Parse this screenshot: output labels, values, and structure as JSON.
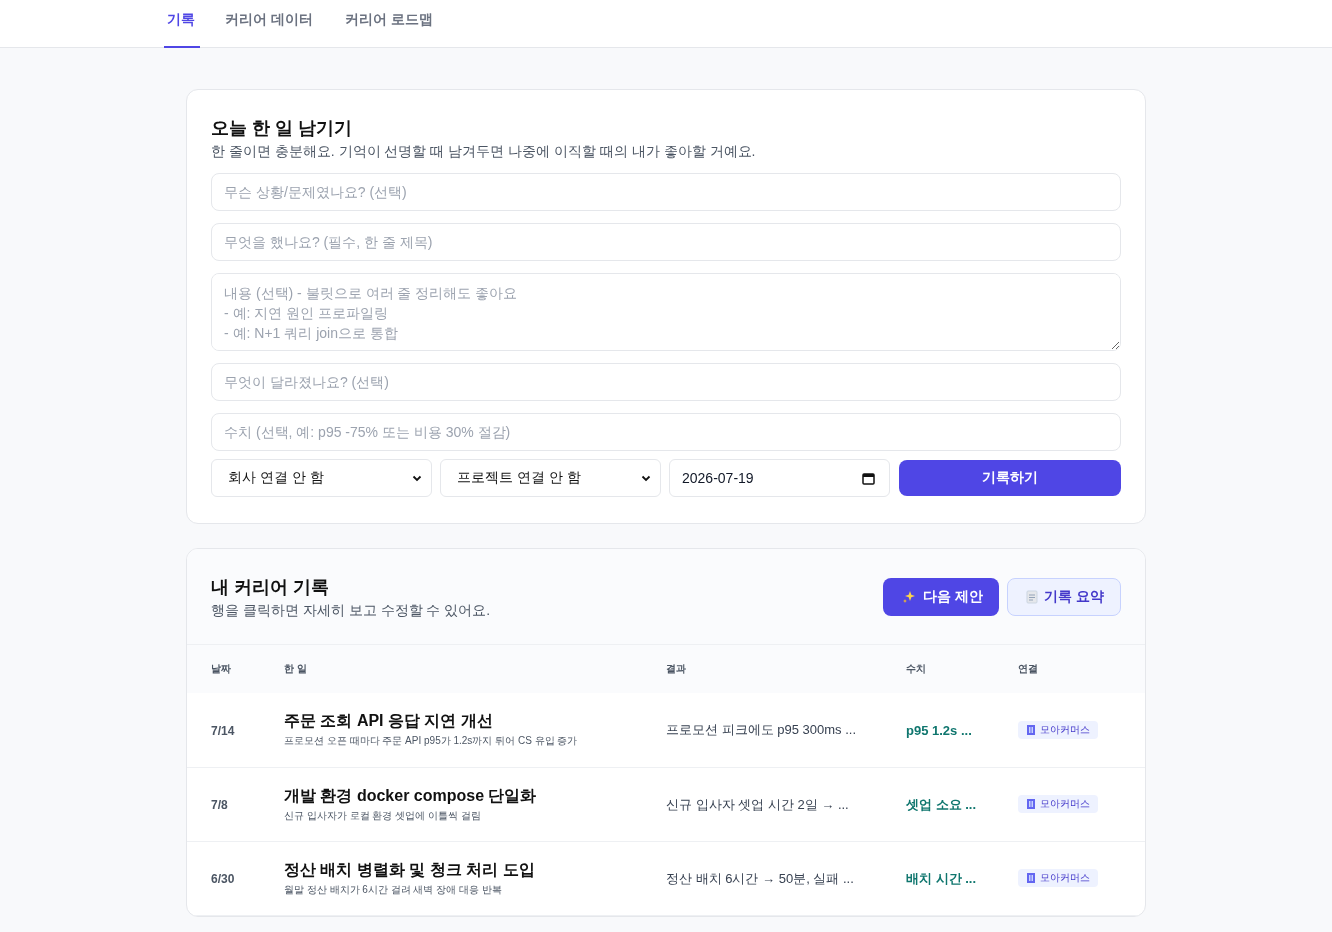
{
  "tabs": [
    {
      "label": "기록",
      "selected": true
    },
    {
      "label": "커리어 데이터",
      "selected": false
    },
    {
      "label": "커리어 로드맵",
      "selected": false
    }
  ],
  "entry_form": {
    "title": "오늘 한 일 남기기",
    "subtitle": "한 줄이면 충분해요. 기억이 선명할 때 남겨두면 나중에 이직할 때의 내가 좋아할 거예요.",
    "fields": [
      {
        "kind": "input",
        "placeholder": "무슨 상황/문제였나요? (선택)"
      },
      {
        "kind": "input",
        "placeholder": "무엇을 했나요? (필수, 한 줄 제목)"
      },
      {
        "kind": "textarea",
        "placeholder": "내용 (선택) - 불릿으로 여러 줄 정리해도 좋아요\n- 예: 지연 원인 프로파일링\n- 예: N+1 쿼리 join으로 통합"
      },
      {
        "kind": "input",
        "placeholder": "무엇이 달라졌나요? (선택)"
      },
      {
        "kind": "input",
        "placeholder": "수치 (선택, 예: p95 -75% 또는 비용 30% 절감)"
      }
    ],
    "company_select": "회사 연결 안 함",
    "project_select": "프로젝트 연결 안 함",
    "date": "2026-07-19",
    "submit_button": "기록하기"
  },
  "records": {
    "title": "내 커리어 기록",
    "subtitle": "행을 클릭하면 자세히 보고 수정할 수 있어요.",
    "buttons": [
      {
        "kind": "primary",
        "label": "다음 제안"
      },
      {
        "kind": "secondary",
        "label": "기록 요약"
      }
    ],
    "columns": [
      "날짜",
      "한 일",
      "결과",
      "수치",
      "연결"
    ],
    "rows": [
      {
        "date": "7/14",
        "title": "주문 조회 API 응답 지연 개선",
        "context": "프로모션 오픈 때마다 주문 API p95가 1.2s까지 튀어 CS 유입 증가",
        "result": "프로모션 피크에도 p95 300ms ...",
        "metric": "p95 1.2s ...",
        "link": "모아커머스"
      },
      {
        "date": "7/8",
        "title": "개발 환경 docker compose 단일화",
        "context": "신규 입사자가 로컬 환경 셋업에 이틀씩 걸림",
        "result": "신규 입사자 셋업 시간 2일 → ...",
        "metric": "셋업 소요 ...",
        "link": "모아커머스"
      },
      {
        "date": "6/30",
        "title": "정산 배치 병렬화 및 청크 처리 도입",
        "context": "월말 정산 배치가 6시간 걸려 새벽 장애 대응 반복",
        "result": "정산 배치 6시간 → 50분, 실패 ...",
        "metric": "배치 시간 ...",
        "link": "모아커머스"
      }
    ]
  }
}
